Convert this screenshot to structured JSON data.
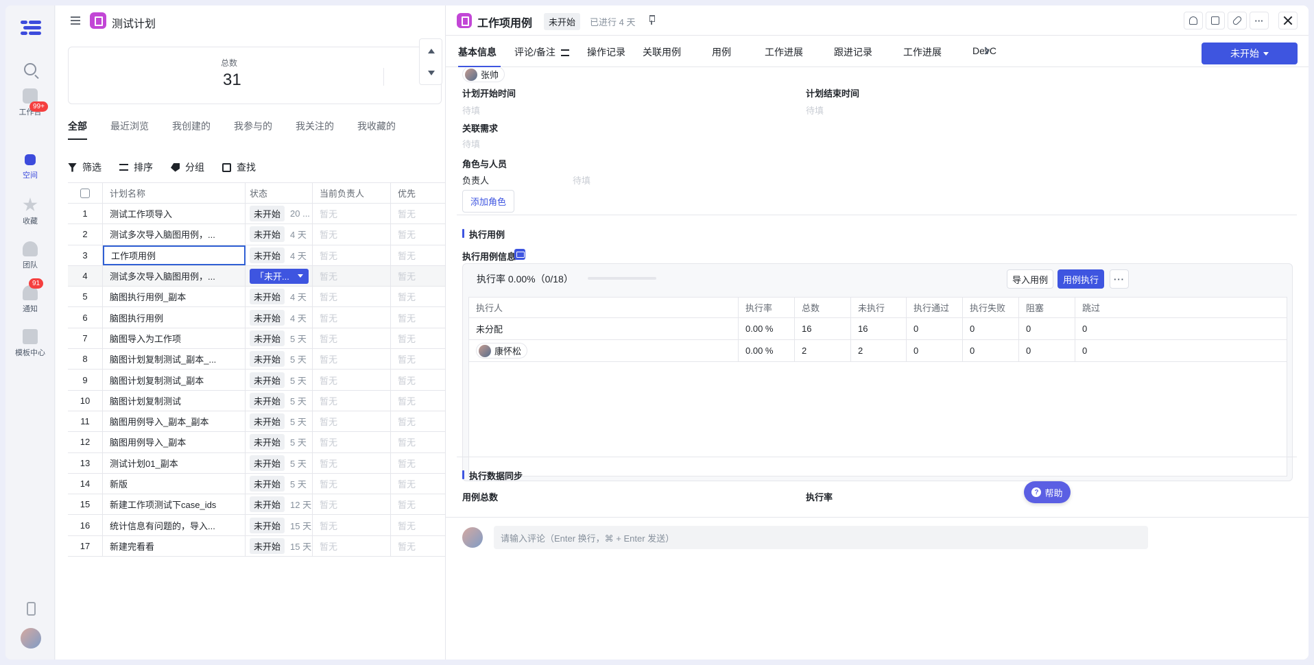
{
  "rail": {
    "items": [
      {
        "label": "工作台",
        "badge": "99+"
      },
      {
        "label": "空间",
        "badge": ""
      },
      {
        "label": "收藏",
        "badge": ""
      },
      {
        "label": "团队",
        "badge": ""
      },
      {
        "label": "通知",
        "badge": "91"
      },
      {
        "label": "模板中心",
        "badge": ""
      }
    ]
  },
  "main": {
    "title": "测试计划",
    "stat": {
      "label": "总数",
      "value": "31"
    },
    "tabs": [
      "全部",
      "最近浏览",
      "我创建的",
      "我参与的",
      "我关注的",
      "我收藏的"
    ],
    "toolbar": [
      "筛选",
      "排序",
      "分组",
      "查找"
    ],
    "columns": [
      "计划名称",
      "状态",
      "当前负责人",
      "优先"
    ],
    "rows": [
      {
        "idx": "1",
        "name": "测试工作项导入",
        "status": "未开始",
        "days": "20 ...",
        "owner": "暂无",
        "pri": "暂无"
      },
      {
        "idx": "2",
        "name": "测试多次导入脑图用例，...",
        "status": "未开始",
        "days": "4 天",
        "owner": "暂无",
        "pri": "暂无"
      },
      {
        "idx": "3",
        "name": "工作项用例",
        "status": "未开始",
        "days": "4 天",
        "owner": "暂无",
        "pri": "暂无"
      },
      {
        "idx": "4",
        "name": "测试多次导入脑图用例，...",
        "status": "「未开...",
        "days": "",
        "owner": "暂无",
        "pri": "暂无"
      },
      {
        "idx": "5",
        "name": "脑图执行用例_副本",
        "status": "未开始",
        "days": "4 天",
        "owner": "暂无",
        "pri": "暂无"
      },
      {
        "idx": "6",
        "name": "脑图执行用例",
        "status": "未开始",
        "days": "4 天",
        "owner": "暂无",
        "pri": "暂无"
      },
      {
        "idx": "7",
        "name": "脑图导入为工作项",
        "status": "未开始",
        "days": "5 天",
        "owner": "暂无",
        "pri": "暂无"
      },
      {
        "idx": "8",
        "name": "脑图计划复制测试_副本_...",
        "status": "未开始",
        "days": "5 天",
        "owner": "暂无",
        "pri": "暂无"
      },
      {
        "idx": "9",
        "name": "脑图计划复制测试_副本",
        "status": "未开始",
        "days": "5 天",
        "owner": "暂无",
        "pri": "暂无"
      },
      {
        "idx": "10",
        "name": "脑图计划复制测试",
        "status": "未开始",
        "days": "5 天",
        "owner": "暂无",
        "pri": "暂无"
      },
      {
        "idx": "11",
        "name": "脑图用例导入_副本_副本",
        "status": "未开始",
        "days": "5 天",
        "owner": "暂无",
        "pri": "暂无"
      },
      {
        "idx": "12",
        "name": "脑图用例导入_副本",
        "status": "未开始",
        "days": "5 天",
        "owner": "暂无",
        "pri": "暂无"
      },
      {
        "idx": "13",
        "name": "测试计划01_副本",
        "status": "未开始",
        "days": "5 天",
        "owner": "暂无",
        "pri": "暂无"
      },
      {
        "idx": "14",
        "name": "新版",
        "status": "未开始",
        "days": "5 天",
        "owner": "暂无",
        "pri": "暂无"
      },
      {
        "idx": "15",
        "name": "新建工作项测试下case_ids",
        "status": "未开始",
        "days": "12 天",
        "owner": "暂无",
        "pri": "暂无"
      },
      {
        "idx": "16",
        "name": "统计信息有问题的，导入...",
        "status": "未开始",
        "days": "15 天",
        "owner": "暂无",
        "pri": "暂无"
      },
      {
        "idx": "17",
        "name": "新建完看看",
        "status": "未开始",
        "days": "15 天",
        "owner": "暂无",
        "pri": "暂无"
      }
    ]
  },
  "detail": {
    "title": "工作项用例",
    "status": "未开始",
    "elapsed": "已进行 4 天",
    "tabs": [
      "基本信息",
      "评论/备注",
      "操作记录",
      "关联用例",
      "用例",
      "工作进展",
      "跟进记录",
      "工作进展",
      "DevC"
    ],
    "primary_button": "未开始",
    "assignee_chip": "张帅",
    "fields": {
      "plan_start_label": "计划开始时间",
      "plan_start_value": "待填",
      "plan_end_label": "计划结束时间",
      "plan_end_value": "待填",
      "related_label": "关联需求",
      "related_value": "待填",
      "roles_label": "角色与人员",
      "owner_label": "负责人",
      "owner_value": "待填",
      "add_role": "添加角色"
    },
    "exec_section": {
      "title": "执行用例",
      "info_label": "执行用例信息",
      "rate_text": "执行率 0.00%（0/18）",
      "progress": 0.0,
      "import_btn": "导入用例",
      "run_btn": "用例执行",
      "more_btn": "···",
      "columns": [
        "执行人",
        "执行率",
        "总数",
        "未执行",
        "执行通过",
        "执行失败",
        "阻塞",
        "跳过"
      ],
      "rows": [
        {
          "executor": "未分配",
          "avatar": false,
          "rate": "0.00 %",
          "total": "16",
          "pending": "16",
          "pass": "0",
          "fail": "0",
          "blocked": "0",
          "skip": "0"
        },
        {
          "executor": "康怀松",
          "avatar": true,
          "rate": "0.00 %",
          "total": "2",
          "pending": "2",
          "pass": "0",
          "fail": "0",
          "blocked": "0",
          "skip": "0"
        }
      ]
    },
    "sync_section": {
      "title": "执行数据同步",
      "total_label": "用例总数",
      "rate_label": "执行率"
    },
    "help": "帮助",
    "comment_placeholder": "请输入评论（Enter 换行，⌘ + Enter 发送）"
  }
}
